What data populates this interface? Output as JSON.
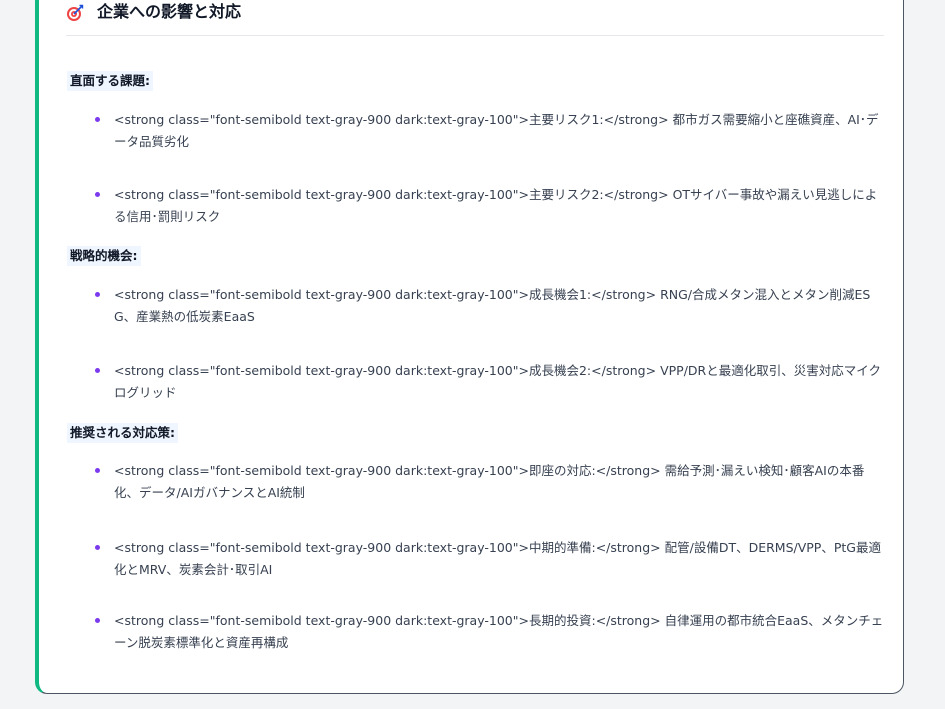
{
  "header": {
    "icon": "target-icon",
    "title": "企業への影響と対応"
  },
  "accent_color": "#10b981",
  "bullet_color": "#7c3aed",
  "sections": [
    {
      "label": "直面する課題:",
      "items": [
        "<strong class=\"font-semibold text-gray-900 dark:text-gray-100\">主要リスク1:</strong> 都市ガス需要縮小と座礁資産、AI･データ品質劣化",
        "<strong class=\"font-semibold text-gray-900 dark:text-gray-100\">主要リスク2:</strong> OTサイバー事故や漏えい見逃しによる信用･罰則リスク"
      ]
    },
    {
      "label": "戦略的機会:",
      "items": [
        "<strong class=\"font-semibold text-gray-900 dark:text-gray-100\">成長機会1:</strong> RNG/合成メタン混入とメタン削減ESG、産業熱の低炭素EaaS",
        "<strong class=\"font-semibold text-gray-900 dark:text-gray-100\">成長機会2:</strong> VPP/DRと最適化取引、災害対応マイクログリッド"
      ]
    },
    {
      "label": "推奨される対応策:",
      "items": [
        "<strong class=\"font-semibold text-gray-900 dark:text-gray-100\">即座の対応:</strong> 需給予測･漏えい検知･顧客AIの本番化、データ/AIガバナンスとAI統制",
        "<strong class=\"font-semibold text-gray-900 dark:text-gray-100\">中期的準備:</strong> 配管/設備DT、DERMS/VPP、PtG最適化とMRV、炭素会計･取引AI",
        "<strong class=\"font-semibold text-gray-900 dark:text-gray-100\">長期的投資:</strong> 自律運用の都市統合EaaS、メタンチェーン脱炭素標準化と資産再構成"
      ]
    }
  ]
}
